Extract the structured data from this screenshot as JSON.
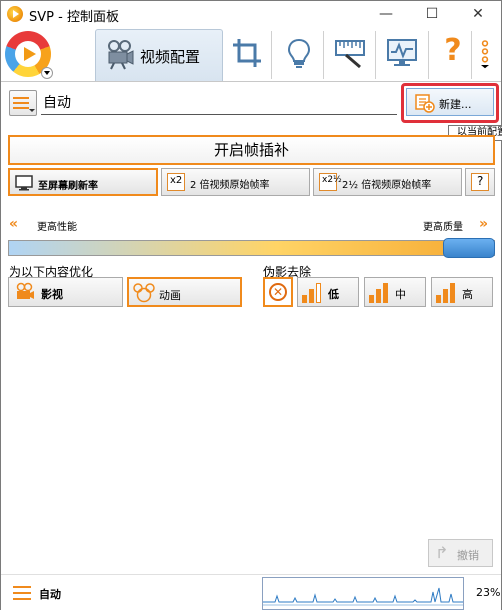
{
  "window": {
    "title": "SVP - 控制面板",
    "minimize": "—",
    "maximize": "☐",
    "close": "✕"
  },
  "toolbar": {
    "active_tab": "视频配置",
    "icons": [
      "crop-icon",
      "lightbulb-icon",
      "ruler-icon",
      "monitor-icon",
      "help-icon",
      "more-icon"
    ],
    "help_glyph": "?"
  },
  "profile": {
    "name": "自动",
    "new_button": "新建...",
    "tooltip": "以当前配置"
  },
  "frame_interpolation": {
    "main_button": "开启帧插补",
    "rate_options": [
      {
        "icon_text": "",
        "label": "至屏幕刷新率",
        "selected": true
      },
      {
        "icon_text": "x2",
        "label": "2 倍视频原始帧率",
        "selected": false
      },
      {
        "icon_text": "x2½",
        "label": "2½ 倍视频原始帧率",
        "selected": false
      },
      {
        "icon_text": "?",
        "label": "",
        "selected": false
      }
    ]
  },
  "quality": {
    "left_label": "更高性能",
    "right_label": "更高质量",
    "level": 1.0
  },
  "optimize": {
    "label": "为以下内容优化",
    "options": [
      {
        "label": "影视",
        "selected": false
      },
      {
        "label": "动画",
        "selected": true
      }
    ]
  },
  "artifacts": {
    "label": "伪影去除",
    "options": [
      {
        "label": "",
        "icon": "off-icon",
        "selected": true
      },
      {
        "label": "低",
        "selected": false
      },
      {
        "label": "中",
        "selected": false
      },
      {
        "label": "高",
        "selected": false
      }
    ]
  },
  "undo": {
    "label": "撤销"
  },
  "status": {
    "profile_name": "自动",
    "cpu_percent": "23%"
  },
  "colors": {
    "accent": "#f08a1c",
    "highlight_frame": "#e0303a",
    "slider_thumb": "#3a84cc"
  }
}
